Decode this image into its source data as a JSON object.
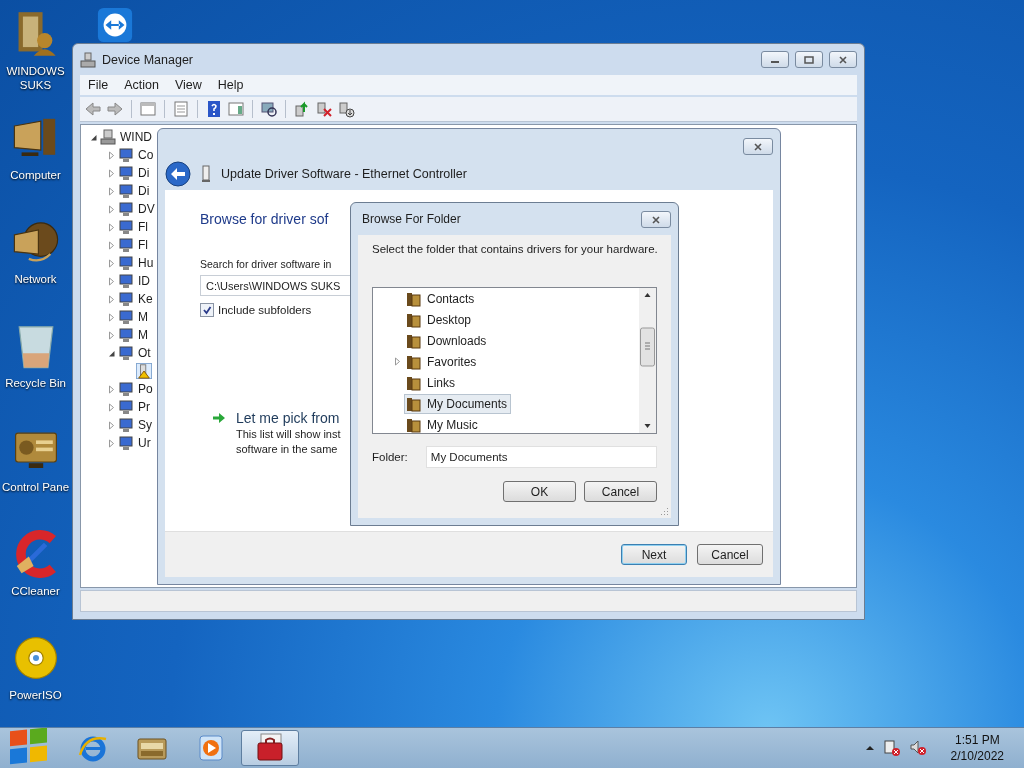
{
  "desktop_icons": [
    {
      "label": "WINDOWS SUKS",
      "kind": "user"
    },
    {
      "label": "Computer",
      "kind": "computer"
    },
    {
      "label": "Network",
      "kind": "network"
    },
    {
      "label": "Recycle Bin",
      "kind": "recycle"
    },
    {
      "label": "Control Pane",
      "kind": "control"
    },
    {
      "label": "CCleaner",
      "kind": "cleaner"
    },
    {
      "label": "PowerISO",
      "kind": "disc"
    }
  ],
  "device_manager": {
    "title": "Device Manager",
    "menu": [
      "File",
      "Action",
      "View",
      "Help"
    ],
    "tree": {
      "label": "WIND",
      "expanded": true,
      "children": [
        {
          "label": "Co",
          "expanded": false
        },
        {
          "label": "Di",
          "expanded": false
        },
        {
          "label": "Di",
          "expanded": false
        },
        {
          "label": "DV",
          "expanded": false
        },
        {
          "label": "Fl",
          "expanded": false
        },
        {
          "label": "Fl",
          "expanded": false
        },
        {
          "label": "Hu",
          "expanded": false
        },
        {
          "label": "ID",
          "expanded": false
        },
        {
          "label": "Ke",
          "expanded": false
        },
        {
          "label": "M",
          "expanded": false
        },
        {
          "label": "M",
          "expanded": false
        },
        {
          "label": "Ot",
          "expanded": true,
          "children": [
            {
              "selected": true
            }
          ]
        },
        {
          "label": "Po",
          "expanded": false
        },
        {
          "label": "Pr",
          "expanded": false
        },
        {
          "label": "Sy",
          "expanded": false
        },
        {
          "label": "Ur",
          "expanded": false
        }
      ]
    }
  },
  "update_dialog": {
    "title": "Update Driver Software - Ethernet Controller",
    "heading": "Browse for driver sof",
    "search_label": "Search for driver software in",
    "path_value": "C:\\Users\\WINDOWS SUKS",
    "include_subfolders": {
      "label": "Include subfolders",
      "checked": true
    },
    "option": {
      "title": "Let me pick from",
      "lines": [
        "This list will show inst",
        "software in the same"
      ]
    },
    "buttons": [
      {
        "label": "Next",
        "default": true
      },
      {
        "label": "Cancel",
        "default": false
      }
    ]
  },
  "browse_dialog": {
    "title": "Browse For Folder",
    "instruction": "Select the folder that contains drivers for your hardware.",
    "folders": [
      {
        "label": "Contacts",
        "expandable": false,
        "selected": false
      },
      {
        "label": "Desktop",
        "expandable": false,
        "selected": false
      },
      {
        "label": "Downloads",
        "expandable": false,
        "selected": false
      },
      {
        "label": "Favorites",
        "expandable": true,
        "selected": false
      },
      {
        "label": "Links",
        "expandable": false,
        "selected": false
      },
      {
        "label": "My Documents",
        "expandable": false,
        "selected": true
      },
      {
        "label": "My Music",
        "expandable": false,
        "selected": false
      }
    ],
    "folder_label": "Folder:",
    "folder_value": "My Documents",
    "buttons": [
      "OK",
      "Cancel"
    ]
  },
  "taskbar": {
    "apps": [
      {
        "kind": "browser",
        "active": false
      },
      {
        "kind": "library",
        "active": false
      },
      {
        "kind": "media",
        "active": false
      },
      {
        "kind": "toolbox",
        "active": true
      }
    ],
    "clock": {
      "time": "1:51 PM",
      "date": "2/10/2022"
    }
  }
}
